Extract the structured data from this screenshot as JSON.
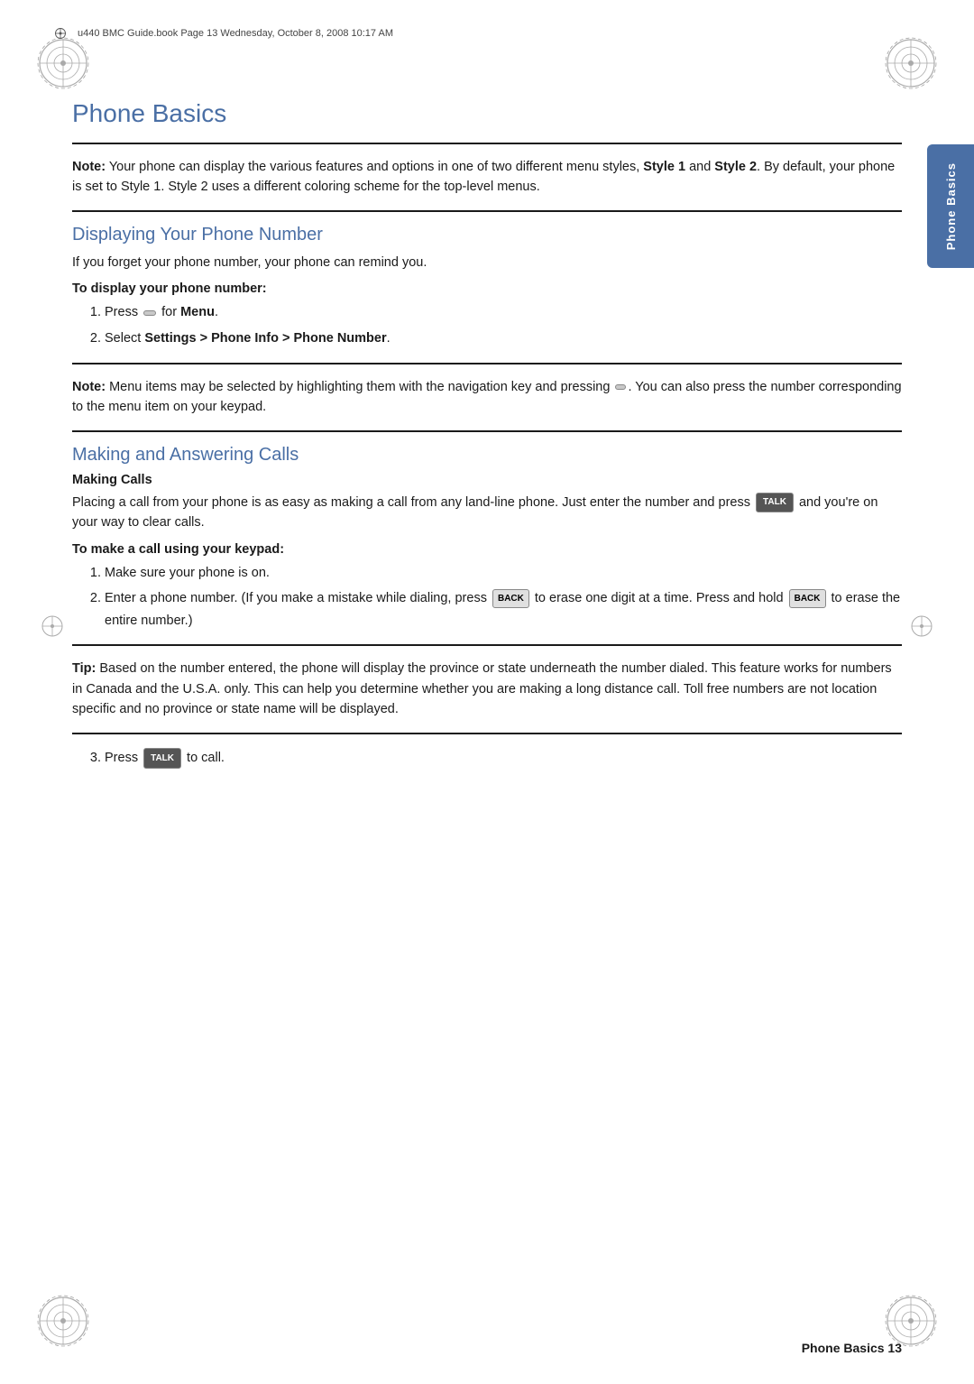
{
  "header": {
    "text": "u440 BMC Guide.book  Page 13  Wednesday, October 8, 2008  10:17 AM"
  },
  "side_tab": {
    "text": "Phone Basics"
  },
  "chapter": {
    "title": "Phone Basics"
  },
  "note1": {
    "label": "Note:",
    "text": "Your phone can display the various features and options in one of two different menu styles, Style 1 and Style 2. By default, your phone is set to Style 1. Style 2 uses a different coloring scheme for the top-level menus."
  },
  "section1": {
    "heading": "Displaying Your Phone Number",
    "intro": "If you forget your phone number, your phone can remind you.",
    "procedure_label": "To display your phone number:",
    "steps": [
      "Press  [Menu button]  for Menu.",
      "Select Settings > Phone Info > Phone Number."
    ]
  },
  "note2": {
    "label": "Note:",
    "text": "Menu items may be selected by highlighting them with the navigation key and pressing  [nav button] . You can also press the number corresponding to the menu item on your keypad."
  },
  "section2": {
    "heading": "Making and Answering Calls",
    "subsection": "Making Calls",
    "intro": "Placing a call from your phone is as easy as making a call from any land-line phone. Just enter the number and press  [TALK]  and you're on your way to clear calls.",
    "procedure_label": "To make a call using your keypad:",
    "steps": [
      "Make sure your phone is on.",
      "Enter a phone number. (If you make a mistake while dialing, press  BACK  to erase one digit at a time. Press and hold  BACK  to erase the entire number.)"
    ]
  },
  "tip1": {
    "label": "Tip:",
    "text": "Based on the number entered, the phone will display the province or state underneath the number dialed. This feature works for numbers in Canada and the U.S.A. only. This can help you determine whether you are making a long distance call. Toll free numbers are not location specific and no province or state name will be displayed."
  },
  "step3": "Press  [TALK]  to call.",
  "footer": {
    "text": "Phone Basics   13"
  }
}
